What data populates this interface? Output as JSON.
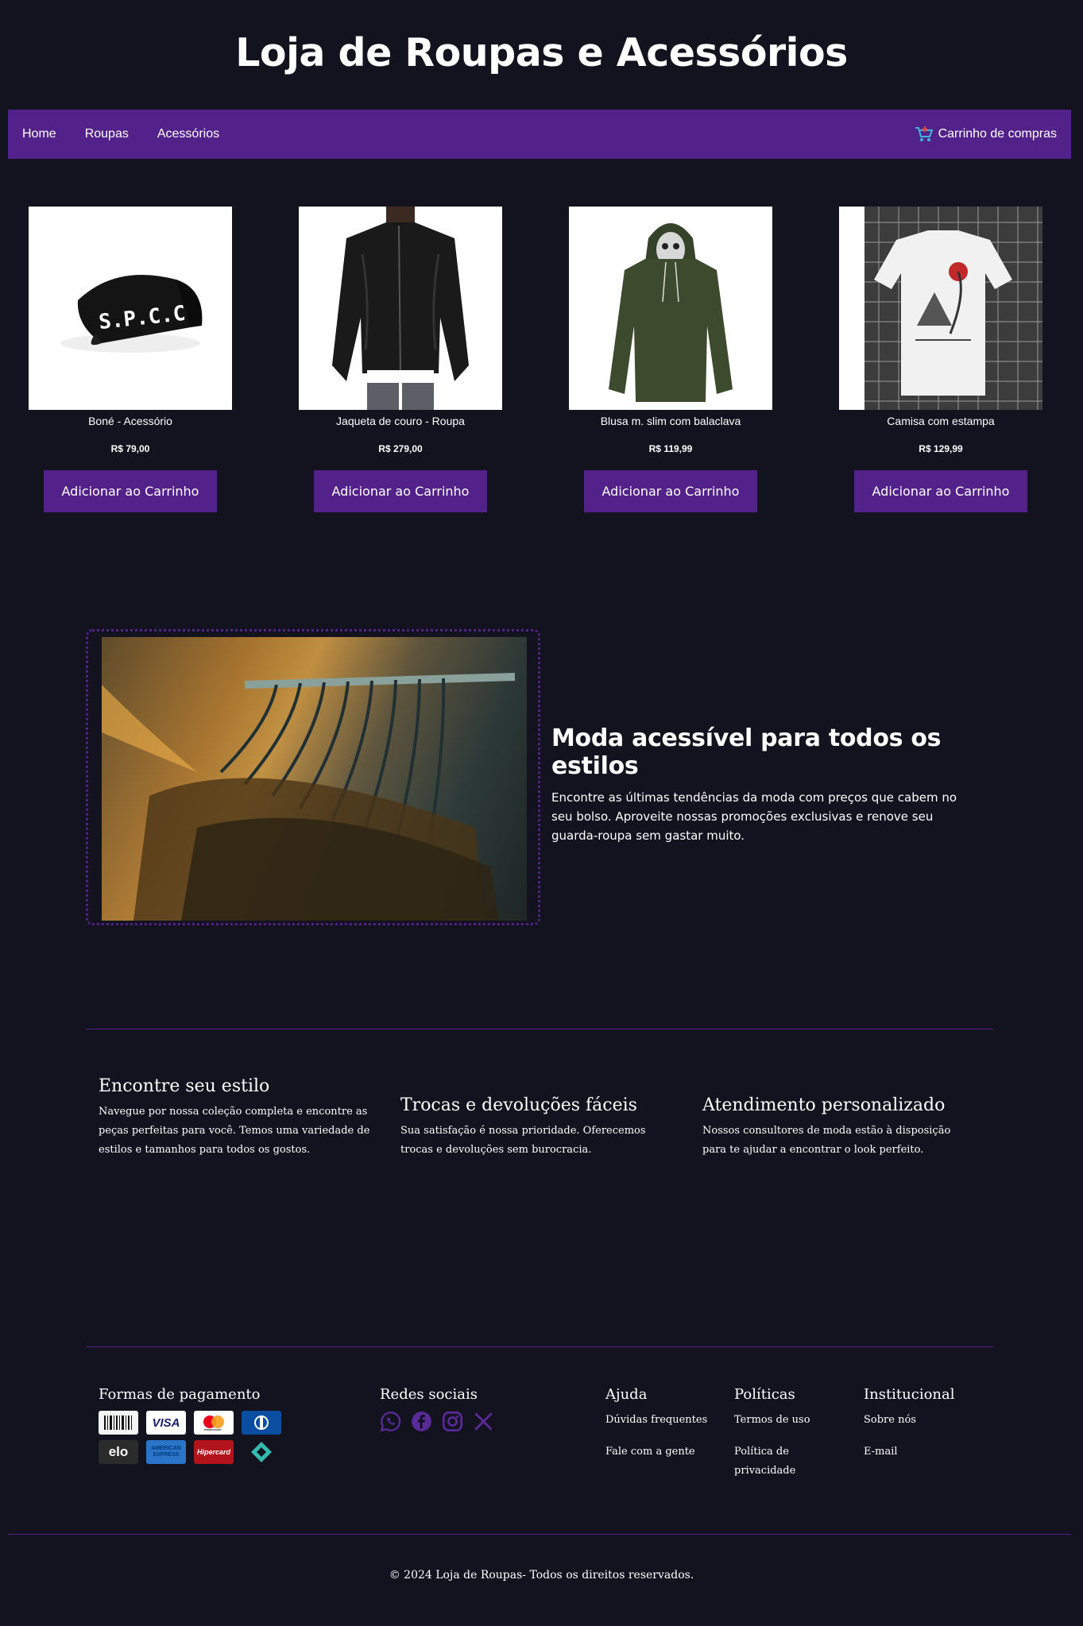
{
  "header": {
    "title": "Loja de Roupas e Acessórios"
  },
  "nav": {
    "links": [
      "Home",
      "Roupas",
      "Acessórios"
    ],
    "cart_label": "Carrinho de compras"
  },
  "products": [
    {
      "name": "Boné - Acessório",
      "price": "R$ 79,00",
      "button": "Adicionar ao Carrinho",
      "image_icon": "cap-image"
    },
    {
      "name": "Jaqueta de couro - Roupa",
      "price": "R$ 279,00",
      "button": "Adicionar ao Carrinho",
      "image_icon": "leather-jacket-image"
    },
    {
      "name": "Blusa m. slim com balaclava",
      "price": "R$ 119,99",
      "button": "Adicionar ao Carrinho",
      "image_icon": "hoodie-image"
    },
    {
      "name": "Camisa com estampa",
      "price": "R$ 129,99",
      "button": "Adicionar ao Carrinho",
      "image_icon": "printed-tshirt-image"
    }
  ],
  "cap_logo_text": "S.P.C.C",
  "hero": {
    "title": "Moda acessível para todos os estilos",
    "text": "Encontre as últimas tendências da moda com preços que cabem no seu bolso. Aproveite nossas promoções exclusivas e renove seu guarda-roupa sem gastar muito."
  },
  "features": [
    {
      "title": "Encontre seu estilo",
      "text": "Navegue por nossa coleção completa e encontre as peças perfeitas para você. Temos uma variedade de estilos e tamanhos para todos os gostos."
    },
    {
      "title": "Trocas e devoluções fáceis",
      "text": "Sua satisfação é nossa prioridade. Oferecemos trocas e devoluções sem burocracia."
    },
    {
      "title": "Atendimento personalizado",
      "text": "Nossos consultores de moda estão à disposição para te ajudar a encontrar o look perfeito."
    }
  ],
  "footer": {
    "payments_title": "Formas de pagamento",
    "payments": [
      "boleto",
      "VISA",
      "mastercard",
      "diners",
      "elo",
      "AMERICAN EXPRESS",
      "Hipercard",
      "pix"
    ],
    "social_title": "Redes sociais",
    "socials": [
      "whatsapp-icon",
      "facebook-icon",
      "instagram-icon",
      "x-icon"
    ],
    "help": {
      "title": "Ajuda",
      "links": [
        "Dúvidas frequentes",
        "Fale com a gente"
      ]
    },
    "policies": {
      "title": "Políticas",
      "links": [
        "Termos de uso",
        "Política de privacidade"
      ]
    },
    "institutional": {
      "title": "Institucional",
      "links": [
        "Sobre nós",
        "E-mail"
      ]
    },
    "copyright": "© 2024 Loja de Roupas- Todos os direitos reservados."
  },
  "colors": {
    "background": "#13121f",
    "accent": "#52228a",
    "text": "#ffffff"
  }
}
